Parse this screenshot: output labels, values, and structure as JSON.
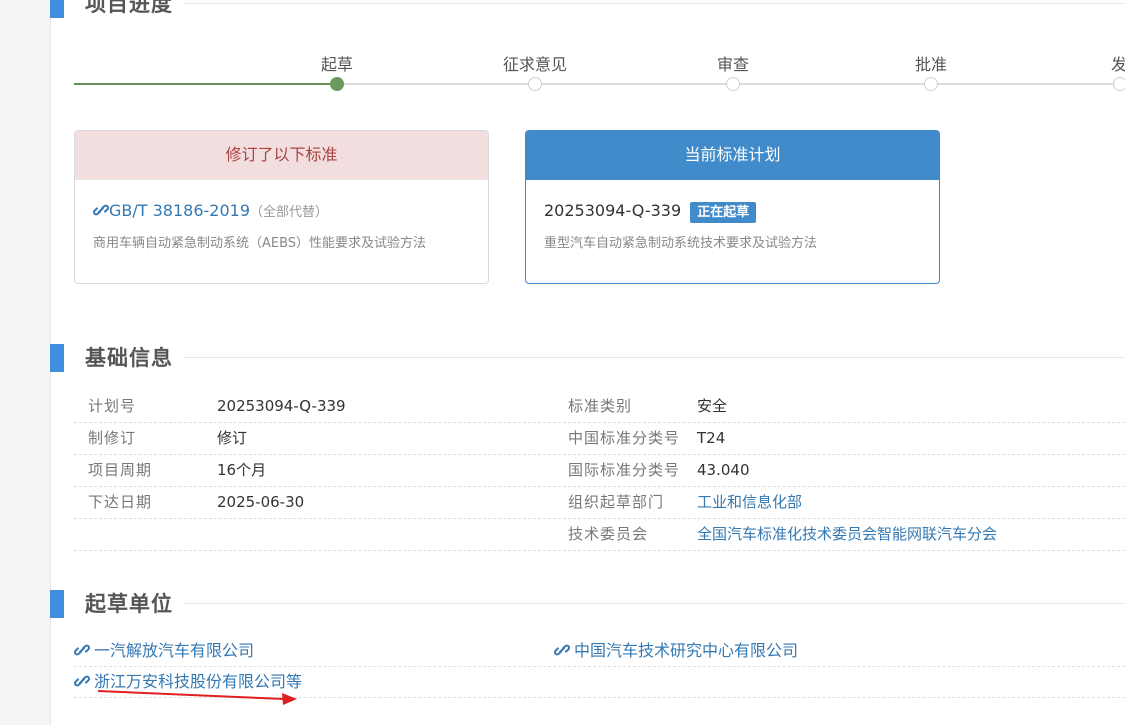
{
  "sections": {
    "progress_title": "项目进度",
    "basic_title": "基础信息",
    "units_title": "起草单位"
  },
  "progress": {
    "steps": [
      {
        "label": "起草",
        "done": true
      },
      {
        "label": "征求意见",
        "done": false
      },
      {
        "label": "审查",
        "done": false
      },
      {
        "label": "批准",
        "done": false
      },
      {
        "label": "发",
        "done": false
      }
    ]
  },
  "revised_card": {
    "title": "修订了以下标准",
    "code": "GB/T 38186-2019",
    "note": "（全部代替）",
    "desc": "商用车辆自动紧急制动系统（AEBS）性能要求及试验方法"
  },
  "current_card": {
    "title": "当前标准计划",
    "code": "20253094-Q-339",
    "badge": "正在起草",
    "desc": "重型汽车自动紧急制动系统技术要求及试验方法"
  },
  "basic_info": {
    "rows": [
      {
        "l1": "计划号",
        "v1": "20253094-Q-339",
        "l2": "标准类别",
        "v2": "安全"
      },
      {
        "l1": "制修订",
        "v1": "修订",
        "l2": "中国标准分类号",
        "v2": "T24"
      },
      {
        "l1": "项目周期",
        "v1": "16个月",
        "l2": "国际标准分类号",
        "v2": "43.040"
      },
      {
        "l1": "下达日期",
        "v1": "2025-06-30",
        "l2": "组织起草部门",
        "v2": "工业和信息化部"
      },
      {
        "l1": "",
        "v1": "",
        "l2": "技术委员会",
        "v2": "全国汽车标准化技术委员会智能网联汽车分会"
      }
    ]
  },
  "units": {
    "items": [
      "一汽解放汽车有限公司",
      "中国汽车技术研究中心有限公司",
      "浙江万安科技股份有限公司等"
    ]
  },
  "colors": {
    "accent": "#418bca",
    "progress_done": "#6b9a5e",
    "revised_bg": "#f2dede",
    "revised_text": "#a94442",
    "link": "#3478b2",
    "annotation_arrow": "#e02020"
  }
}
